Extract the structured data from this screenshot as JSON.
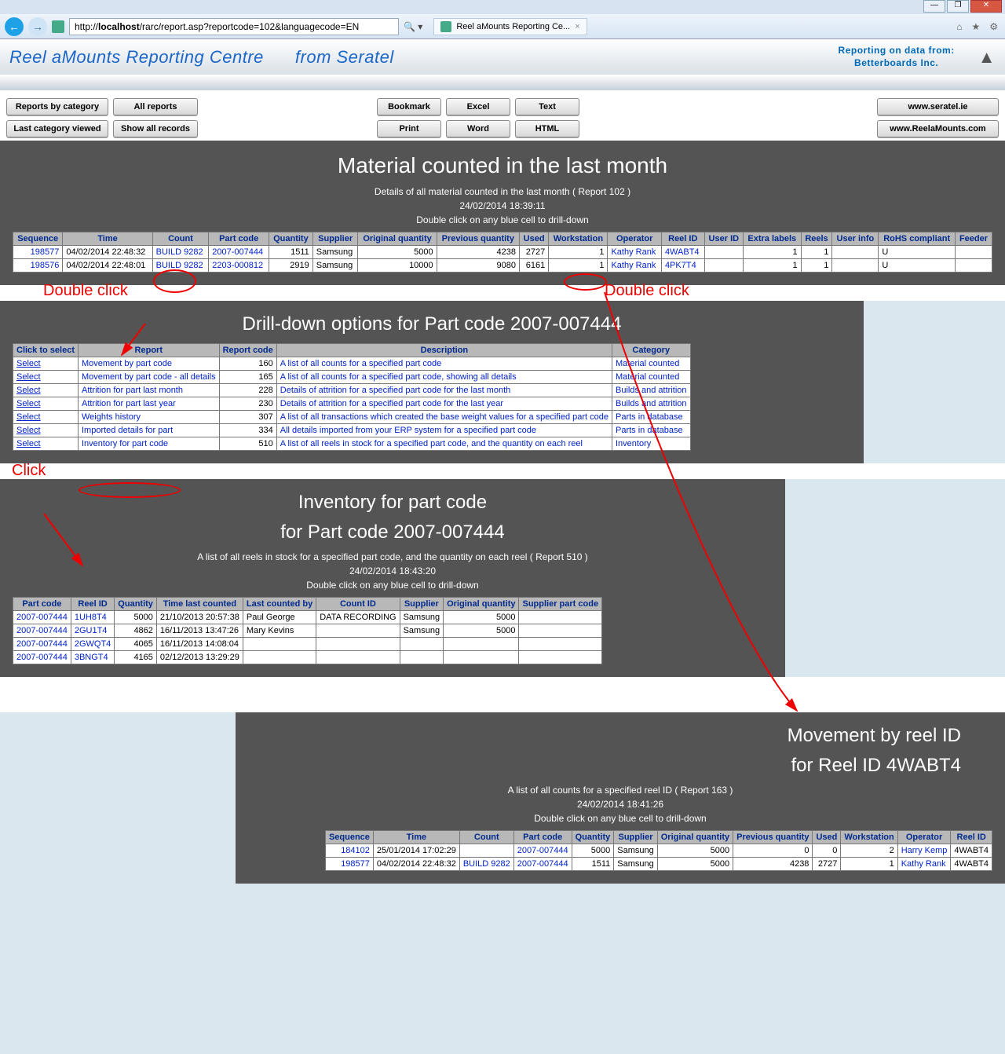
{
  "chrome": {
    "url_prefix": "http://",
    "url_host": "localhost",
    "url_path": "/rarc/report.asp?reportcode=102&languagecode=EN",
    "tab_title": "Reel aMounts Reporting Ce..."
  },
  "banner": {
    "brand_left": "Reel aMounts Reporting Centre",
    "brand_right": "from Seratel",
    "reporting_line1": "Reporting on data from:",
    "reporting_line2": "Betterboards Inc."
  },
  "toolbar": {
    "reports_by_category": "Reports by category",
    "all_reports": "All reports",
    "last_category_viewed": "Last category viewed",
    "show_all_records": "Show all records",
    "bookmark": "Bookmark",
    "print": "Print",
    "excel": "Excel",
    "word": "Word",
    "text": "Text",
    "html": "HTML",
    "site1": "www.seratel.ie",
    "site2": "www.ReelaMounts.com"
  },
  "report_main": {
    "title": "Material counted in the last month",
    "subtitle": "Details of all material counted in the last month   ( Report 102 )",
    "timestamp": "24/02/2014 18:39:11",
    "hint": "Double click on any blue cell to drill-down",
    "columns": [
      "Sequence",
      "Time",
      "Count",
      "Part code",
      "Quantity",
      "Supplier",
      "Original quantity",
      "Previous quantity",
      "Used",
      "Workstation",
      "Operator",
      "Reel ID",
      "User ID",
      "Extra labels",
      "Reels",
      "User info",
      "RoHS compliant",
      "Feeder"
    ],
    "rows": [
      {
        "seq": "198577",
        "time": "04/02/2014 22:48:32",
        "count": "BUILD 9282",
        "part": "2007-007444",
        "qty": "1511",
        "supp": "Samsung",
        "orig": "5000",
        "prev": "4238",
        "used": "2727",
        "ws": "1",
        "op": "Kathy Rank",
        "reel": "4WABT4",
        "uid": "",
        "extra": "1",
        "reels": "1",
        "uinfo": "",
        "rohs": "U",
        "feeder": ""
      },
      {
        "seq": "198576",
        "time": "04/02/2014 22:48:01",
        "count": "BUILD 9282",
        "part": "2203-000812",
        "qty": "2919",
        "supp": "Samsung",
        "orig": "10000",
        "prev": "9080",
        "used": "6161",
        "ws": "1",
        "op": "Kathy Rank",
        "reel": "4PK7T4",
        "uid": "",
        "extra": "1",
        "reels": "1",
        "uinfo": "",
        "rohs": "U",
        "feeder": ""
      }
    ]
  },
  "ann": {
    "dbl1": "Double click",
    "dbl2": "Double click",
    "click": "Click"
  },
  "drilldown": {
    "title": "Drill-down options for Part code 2007-007444",
    "columns": [
      "Click to select",
      "Report",
      "Report code",
      "Description",
      "Category"
    ],
    "rows": [
      {
        "report": "Movement by part code",
        "code": "160",
        "desc": "A list of all counts for a specified part code",
        "cat": "Material counted"
      },
      {
        "report": "Movement by part code - all details",
        "code": "165",
        "desc": "A list of all counts for a specified part code, showing all details",
        "cat": "Material counted"
      },
      {
        "report": "Attrition for part last month",
        "code": "228",
        "desc": "Details of attrition for a specified part code for the last month",
        "cat": "Builds and attrition"
      },
      {
        "report": "Attrition for part last year",
        "code": "230",
        "desc": "Details of attrition for a specified part code for the last year",
        "cat": "Builds and attrition"
      },
      {
        "report": "Weights history",
        "code": "307",
        "desc": "A list of all transactions which created the base weight values for a specified part code",
        "cat": "Parts in database"
      },
      {
        "report": "Imported details for part",
        "code": "334",
        "desc": "All details imported from your ERP system for a specified part code",
        "cat": "Parts in database"
      },
      {
        "report": "Inventory for part code",
        "code": "510",
        "desc": "A list of all reels in stock for a specified part code, and the quantity on each reel",
        "cat": "Inventory"
      }
    ],
    "select_label": "Select"
  },
  "inventory": {
    "title1": "Inventory for part code",
    "title2": "for Part code 2007-007444",
    "sub": "A list of all reels in stock for a specified part code, and the quantity on each reel   ( Report 510 )",
    "timestamp": "24/02/2014 18:43:20",
    "hint": "Double click on any blue cell to drill-down",
    "columns": [
      "Part code",
      "Reel ID",
      "Quantity",
      "Time last counted",
      "Last counted by",
      "Count ID",
      "Supplier",
      "Original quantity",
      "Supplier part code"
    ],
    "rows": [
      {
        "part": "2007-007444",
        "reel": "1UH8T4",
        "qty": "5000",
        "tlc": "21/10/2013 20:57:38",
        "lcb": "Paul George",
        "cid": "DATA RECORDING",
        "supp": "Samsung",
        "orig": "5000",
        "spc": ""
      },
      {
        "part": "2007-007444",
        "reel": "2GU1T4",
        "qty": "4862",
        "tlc": "16/11/2013 13:47:26",
        "lcb": "Mary Kevins",
        "cid": "",
        "supp": "Samsung",
        "orig": "5000",
        "spc": ""
      },
      {
        "part": "2007-007444",
        "reel": "2GWQT4",
        "qty": "4065",
        "tlc": "16/11/2013 14:08:04",
        "lcb": "",
        "cid": "",
        "supp": "",
        "orig": "",
        "spc": ""
      },
      {
        "part": "2007-007444",
        "reel": "3BNGT4",
        "qty": "4165",
        "tlc": "02/12/2013 13:29:29",
        "lcb": "",
        "cid": "",
        "supp": "",
        "orig": "",
        "spc": ""
      }
    ]
  },
  "movement": {
    "title1": "Movement by reel ID",
    "title2": "for Reel ID 4WABT4",
    "sub": "A list of all counts for a specified reel ID   ( Report 163 )",
    "timestamp": "24/02/2014 18:41:26",
    "hint": "Double click on any blue cell to drill-down",
    "columns": [
      "Sequence",
      "Time",
      "Count",
      "Part code",
      "Quantity",
      "Supplier",
      "Original quantity",
      "Previous quantity",
      "Used",
      "Workstation",
      "Operator",
      "Reel ID"
    ],
    "rows": [
      {
        "seq": "184102",
        "time": "25/01/2014 17:02:29",
        "count": "",
        "part": "2007-007444",
        "qty": "5000",
        "supp": "Samsung",
        "orig": "5000",
        "prev": "0",
        "used": "0",
        "ws": "2",
        "op": "Harry Kemp",
        "reel": "4WABT4"
      },
      {
        "seq": "198577",
        "time": "04/02/2014 22:48:32",
        "count": "BUILD 9282",
        "part": "2007-007444",
        "qty": "1511",
        "supp": "Samsung",
        "orig": "5000",
        "prev": "4238",
        "used": "2727",
        "ws": "1",
        "op": "Kathy Rank",
        "reel": "4WABT4"
      }
    ]
  }
}
